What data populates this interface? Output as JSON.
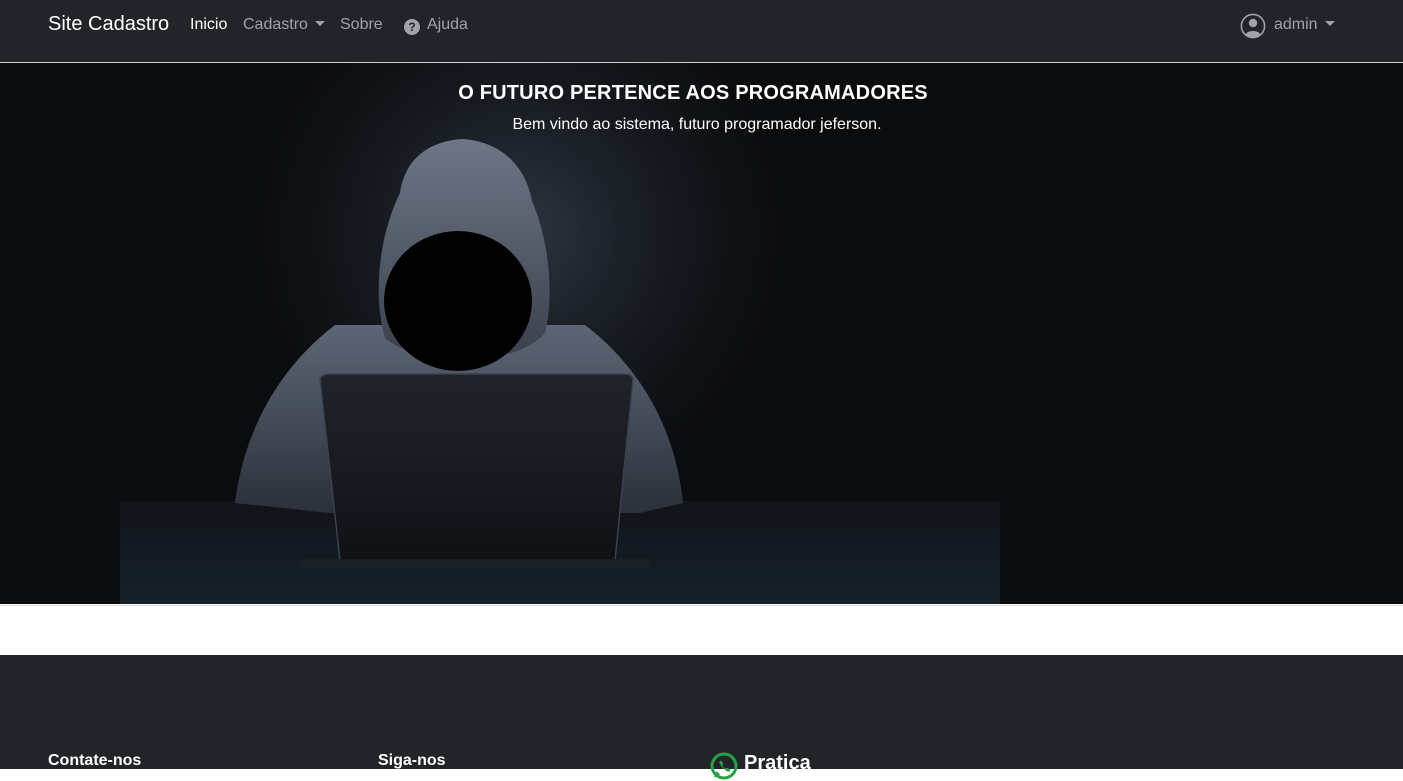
{
  "navbar": {
    "brand": "Site Cadastro",
    "links": [
      {
        "label": "Inicio",
        "active": true
      },
      {
        "label": "Cadastro",
        "dropdown": true
      },
      {
        "label": "Sobre"
      },
      {
        "label": "Ajuda",
        "icon": "help-circle-icon"
      }
    ],
    "user": {
      "label": "admin",
      "icon": "user-circle-icon"
    }
  },
  "hero": {
    "title": "O FUTURO PERTENCE AOS PROGRAMADORES",
    "subtitle": "Bem vindo ao sistema, futuro programador jeferson.",
    "image": "hooded-programmer-with-laptop"
  },
  "footer": {
    "columns": [
      {
        "heading": "Contate-nos"
      },
      {
        "heading": "Siga-nos"
      }
    ],
    "brand": {
      "label": "Pratica",
      "icon": "whatsapp-icon",
      "icon_color": "#25a244"
    }
  },
  "colors": {
    "navbar_bg": "#212529",
    "hero_bg": "#0b0c0e",
    "footer_bg": "#212529",
    "link_muted": "#9ea4aa",
    "text_white": "#ffffff"
  }
}
